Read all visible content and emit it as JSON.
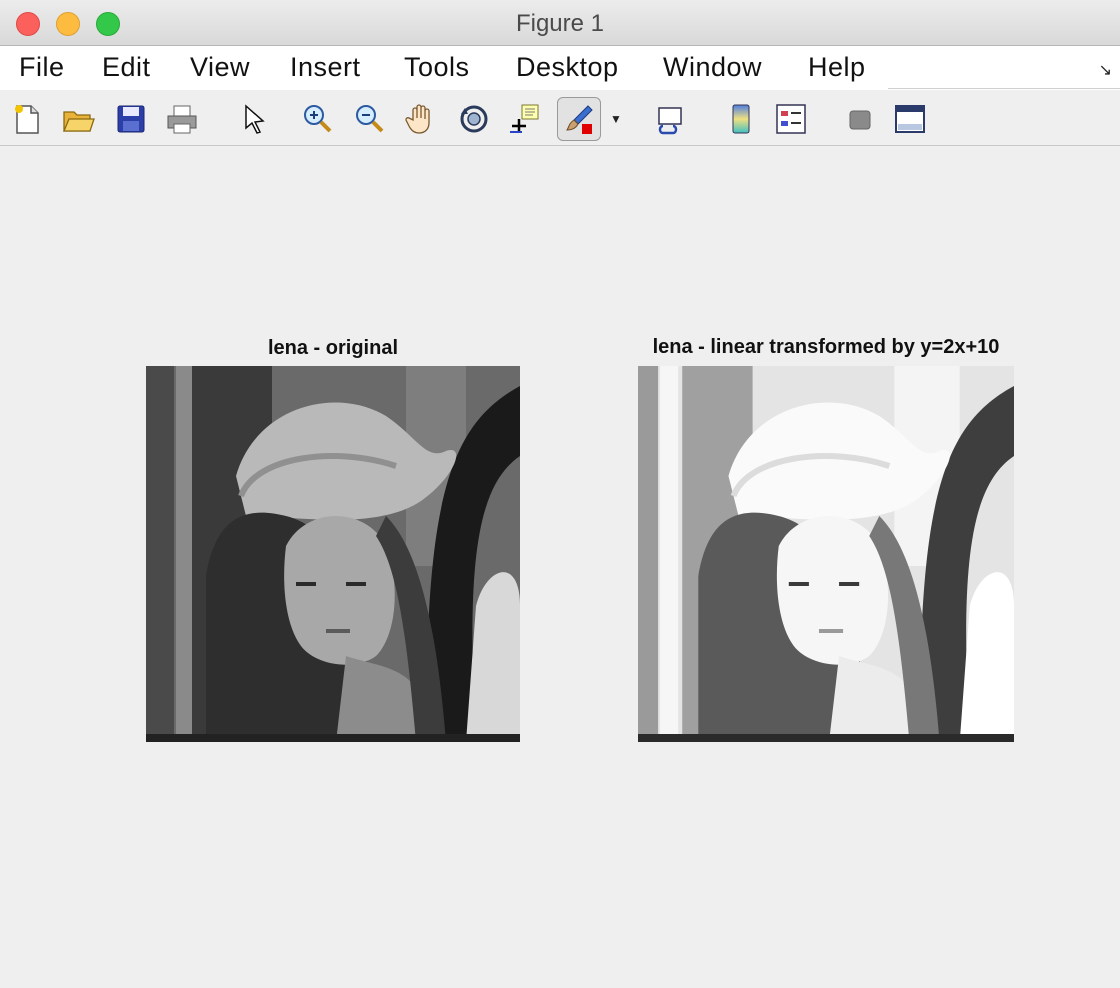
{
  "window": {
    "title": "Figure 1"
  },
  "menu": {
    "items": [
      {
        "label": "File"
      },
      {
        "label": "Edit"
      },
      {
        "label": "View"
      },
      {
        "label": "Insert"
      },
      {
        "label": "Tools"
      },
      {
        "label": "Desktop"
      },
      {
        "label": "Window"
      },
      {
        "label": "Help"
      }
    ]
  },
  "toolbar": {
    "icons": [
      "new-figure-icon",
      "open-file-icon",
      "save-icon",
      "print-icon",
      "pointer-icon",
      "zoom-in-icon",
      "zoom-out-icon",
      "pan-hand-icon",
      "rotate-3d-icon",
      "data-cursor-icon",
      "brush-icon",
      "link-plot-icon",
      "colorbar-icon",
      "legend-icon",
      "hide-plot-tools-icon",
      "show-plot-tools-icon"
    ]
  },
  "axes": [
    {
      "title": "lena - original"
    },
    {
      "title": "lena - linear transformed by y=2x+10"
    }
  ]
}
